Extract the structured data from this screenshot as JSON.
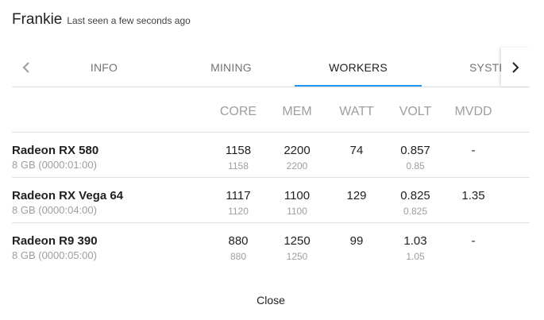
{
  "header": {
    "title": "Frankie",
    "subtitle": "Last seen a few seconds ago"
  },
  "tabs": [
    {
      "label": "INFO",
      "active": false
    },
    {
      "label": "MINING",
      "active": false
    },
    {
      "label": "WORKERS",
      "active": true
    },
    {
      "label": "SYSTEM",
      "active": false
    }
  ],
  "tab_icons": {
    "left": "chevron-left-icon",
    "right": "chevron-right-icon"
  },
  "accent_color": "#2196f3",
  "table": {
    "columns": [
      "CORE",
      "MEM",
      "WATT",
      "VOLT",
      "MVDD"
    ],
    "rows": [
      {
        "name": "Radeon RX 580",
        "details": "8 GB (0000:01:00)",
        "core": "1158",
        "core_sub": "1158",
        "mem": "2200",
        "mem_sub": "2200",
        "watt": "74",
        "volt": "0.857",
        "volt_sub": "0.85",
        "mvdd": "-"
      },
      {
        "name": "Radeon RX Vega 64",
        "details": "8 GB (0000:04:00)",
        "core": "1117",
        "core_sub": "1120",
        "mem": "1100",
        "mem_sub": "1100",
        "watt": "129",
        "volt": "0.825",
        "volt_sub": "0.825",
        "mvdd": "1.35"
      },
      {
        "name": "Radeon R9 390",
        "details": "8 GB (0000:05:00)",
        "core": "880",
        "core_sub": "880",
        "mem": "1250",
        "mem_sub": "1250",
        "watt": "99",
        "volt": "1.03",
        "volt_sub": "1.05",
        "mvdd": "-"
      }
    ]
  },
  "actions": {
    "close_label": "Close"
  }
}
